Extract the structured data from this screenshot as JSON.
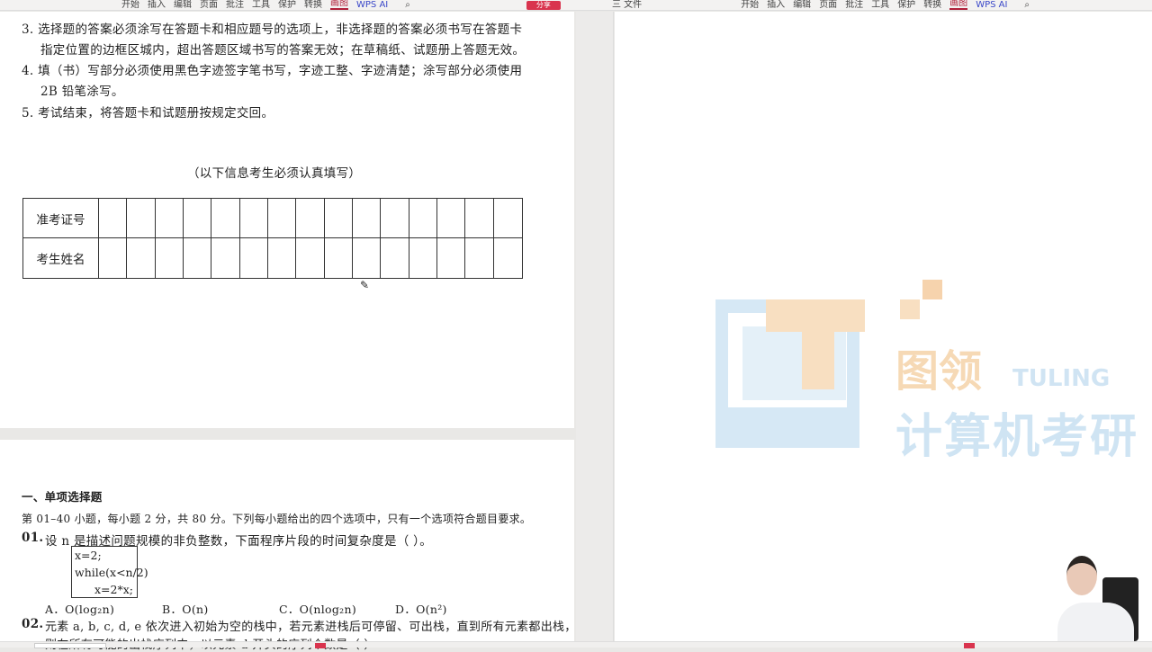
{
  "toolbar": {
    "tabs": [
      "开始",
      "插入",
      "编辑",
      "页面",
      "批注",
      "工具",
      "保护",
      "转换",
      "画图"
    ],
    "active_tab": "画图",
    "ai_label": "WPS AI",
    "file_label": "三 文件",
    "share_label": "分享"
  },
  "notes": [
    "3.  选择题的答案必须涂写在答题卡和相应题号的选项上，非选择题的答案必须书写在答题卡",
    "指定位置的边框区城内，超出答题区域书写的答案无效；在草稿纸、试题册上答题无效。",
    "4.  填（书）写部分必须使用黑色字迹签字笔书写，字迹工整、字迹清楚；涂写部分必须使用",
    "2B 铅笔涂写。",
    "5.  考试结束，将答题卡和试题册按规定交回。"
  ],
  "info_title": "（以下信息考生必须认真填写）",
  "info_table": {
    "rows": [
      "准考证号",
      "考生姓名"
    ]
  },
  "section": {
    "title": "一、单项选择题",
    "intro": "第 01–40 小题，每小题 2 分，共 80 分。下列每小题给出的四个选项中，只有一个选项符合题目要求。",
    "q1": {
      "number": "01.",
      "text": "设 n 是描述问题规模的非负整数，下面程序片段的时间复杂度是（   ）。",
      "code": [
        "x=2;",
        "while(x<n/2)",
        "x=2*x;"
      ],
      "options": [
        "A．O(log₂n)",
        "B．O(n)",
        "C．O(nlog₂n)",
        "D．O(n²)"
      ]
    },
    "q2": {
      "number": "02.",
      "text": "元素 a, b, c, d, e 依次进入初始为空的栈中，若元素进栈后可停留、可出栈，直到所有元素都出栈，",
      "text2": "则在所有可能的出栈序列中，以元素 d 开头的序列个数是（   ）"
    }
  },
  "watermark": {
    "cn": "图领",
    "en": "TULING",
    "sub": "计算机考研"
  },
  "colors": {
    "accent": "#b0203a",
    "wm_orange": "#f6d9b5",
    "wm_blue": "#cfe4f3"
  }
}
